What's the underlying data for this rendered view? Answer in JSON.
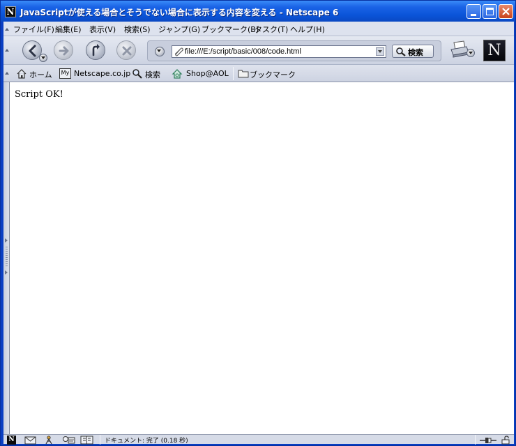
{
  "window": {
    "title": "JavaScriptが使える場合とそうでない場合に表示する内容を変える - Netscape 6",
    "app_icon_letter": "N"
  },
  "menu": {
    "items": [
      {
        "label": "ファイル(F)"
      },
      {
        "label": "編集(E)"
      },
      {
        "label": "表示(V)"
      },
      {
        "label": "検索(S)"
      },
      {
        "label": "ジャンプ(G)"
      },
      {
        "label": "ブックマーク(B)"
      },
      {
        "label": "タスク(T)"
      },
      {
        "label": "ヘルプ(H)"
      }
    ]
  },
  "navigation": {
    "back_icon": "back-arrow-icon",
    "forward_icon": "forward-arrow-icon",
    "reload_icon": "reload-icon",
    "stop_icon": "stop-icon",
    "url": "file:///E:/script/basic/008/code.html",
    "search_label": "検索",
    "logo_letter": "N"
  },
  "personal_toolbar": {
    "items": [
      {
        "label": "ホーム",
        "icon": "home-icon"
      },
      {
        "label": "Netscape.co.jp",
        "icon": "my-netscape-icon",
        "badge": "My"
      },
      {
        "label": "検索",
        "icon": "search-icon"
      },
      {
        "label": "Shop@AOL",
        "icon": "shop-icon"
      },
      {
        "label": "ブックマーク",
        "icon": "folder-icon"
      }
    ]
  },
  "page": {
    "body_text": "Script OK!"
  },
  "status": {
    "text": "ドキュメント: 完了 (0.18 秒)"
  },
  "colors": {
    "titlebar": "#0a54d8",
    "chrome": "#d6dbe9",
    "page_bg": "#ffffff"
  }
}
